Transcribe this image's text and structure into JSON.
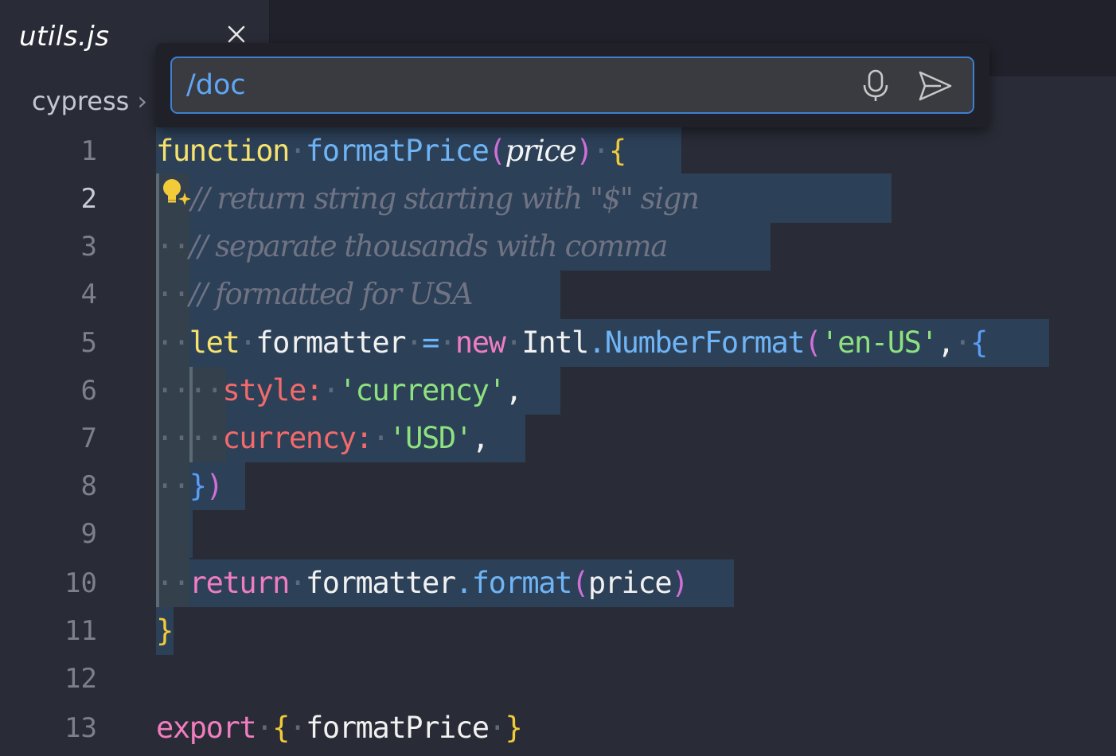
{
  "tab": {
    "title": "utils.js"
  },
  "breadcrumb": {
    "folder": "cypress",
    "sep": "›"
  },
  "chat": {
    "input_value": "/doc"
  },
  "editor": {
    "line_numbers": [
      "1",
      "2",
      "3",
      "4",
      "5",
      "6",
      "7",
      "8",
      "9",
      "10",
      "11",
      "12",
      "13"
    ],
    "lines": {
      "l1": {
        "kw": "function",
        "name": "formatPrice",
        "param": "price"
      },
      "l2": {
        "text": "// return string starting with \"$\" sign"
      },
      "l3": {
        "text": "// separate thousands with comma"
      },
      "l4": {
        "text": "// formatted for USA"
      },
      "l5": {
        "kw": "let",
        "var": "formatter",
        "eq": "=",
        "new": "new",
        "obj": "Intl",
        "cls": "NumberFormat",
        "str": "'en-US'"
      },
      "l6": {
        "prop": "style:",
        "str": "'currency'"
      },
      "l7": {
        "prop": "currency:",
        "str": "'USD'"
      },
      "l10": {
        "kw": "return",
        "var": "formatter",
        "method": "format",
        "arg": "price"
      },
      "l13": {
        "kw": "export",
        "name": "formatPrice"
      }
    }
  },
  "colors": {
    "selection": "#2c4058",
    "accent": "#3d7fd0",
    "background": "#292b36"
  },
  "icons": [
    "close-icon",
    "microphone-icon",
    "send-icon",
    "sparkle-lightbulb-icon"
  ]
}
